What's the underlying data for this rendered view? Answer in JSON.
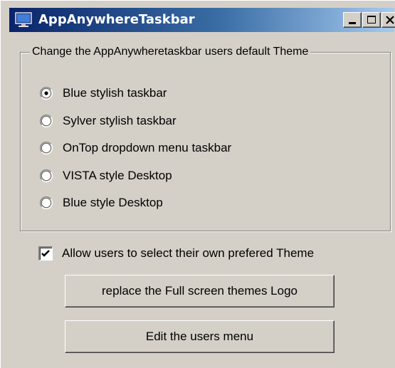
{
  "window": {
    "title": "AppAnywhereTaskbar",
    "icon": "monitor-app-icon",
    "controls": [
      "minimize-icon",
      "maximize-icon",
      "close-icon"
    ]
  },
  "theme_group": {
    "legend": "Change the AppAnywheretaskbar users default Theme",
    "options": [
      {
        "label": "Blue stylish taskbar",
        "selected": true
      },
      {
        "label": "Sylver stylish taskbar",
        "selected": false
      },
      {
        "label": "OnTop dropdown menu taskbar",
        "selected": false
      },
      {
        "label": "VISTA style Desktop",
        "selected": false
      },
      {
        "label": "Blue style Desktop",
        "selected": false
      }
    ]
  },
  "allow_users": {
    "label": "Allow users to select their own prefered Theme",
    "checked": true
  },
  "buttons": {
    "replace_logo": "replace the Full screen themes Logo",
    "edit_menu": "Edit the users menu"
  }
}
